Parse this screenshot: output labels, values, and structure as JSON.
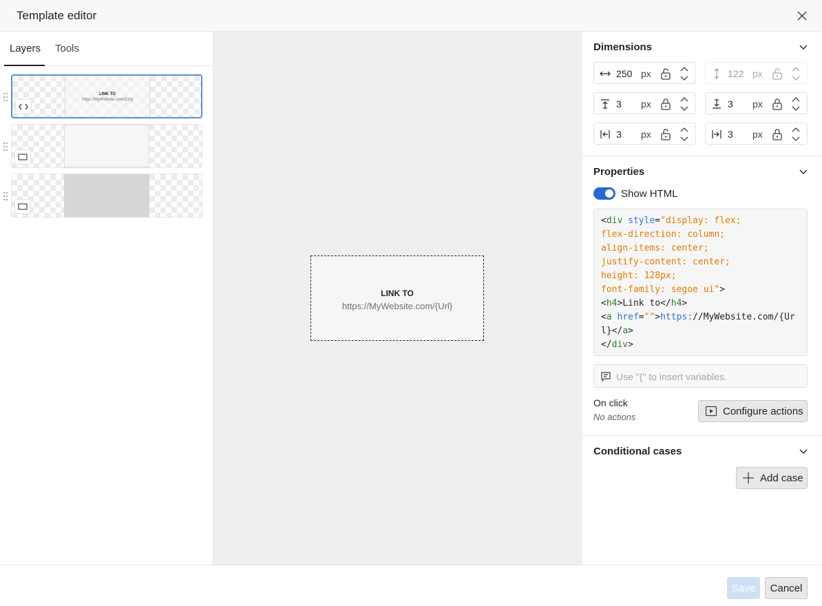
{
  "header": {
    "title": "Template editor"
  },
  "tabs": [
    {
      "label": "Layers"
    },
    {
      "label": "Tools"
    }
  ],
  "layers": [
    {
      "thumb_heading": "LINK TO",
      "thumb_link": "https://MyWebsite.com/{Url}"
    }
  ],
  "preview": {
    "heading": "LINK TO",
    "link": "https://MyWebsite.com/{Url}"
  },
  "dimensions": {
    "title": "Dimensions",
    "width": {
      "value": "250",
      "unit": "px"
    },
    "height": {
      "value": "122",
      "unit": "px"
    },
    "margin_top": {
      "value": "3",
      "unit": "px"
    },
    "margin_bottom": {
      "value": "3",
      "unit": "px"
    },
    "margin_left": {
      "value": "3",
      "unit": "px"
    },
    "margin_right": {
      "value": "3",
      "unit": "px"
    }
  },
  "properties": {
    "title": "Properties",
    "toggle_label": "Show HTML",
    "code": [
      "<div style=\"display: flex;",
      "flex-direction: column;",
      "align-items: center;",
      "justify-content: center;",
      "height: 128px;",
      "font-family: segoe ui\">",
      "<h4>Link to</h4>",
      "<a href=\"\">https://MyWebsite.com/{Ur",
      "l}</a>",
      "</div>"
    ],
    "variables_placeholder": "Use \"{\" to insert variables.",
    "on_click_label": "On click",
    "no_actions": "No actions",
    "configure_actions": "Configure actions"
  },
  "conditional": {
    "title": "Conditional cases",
    "add_case": "Add case"
  },
  "footer": {
    "save": "Save",
    "cancel": "Cancel"
  },
  "colors": {
    "accent": "#2a6ad0",
    "selection": "#5b8ed6"
  }
}
